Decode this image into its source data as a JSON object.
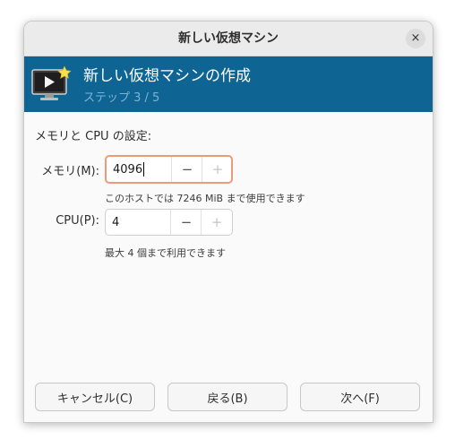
{
  "window": {
    "title": "新しい仮想マシン",
    "close_glyph": "×"
  },
  "banner": {
    "title": "新しい仮想マシンの作成",
    "step": "ステップ 3 / 5",
    "icon": "vm-monitor-icon",
    "accent_color": "#0e6594"
  },
  "form": {
    "section_title": "メモリと CPU の設定:",
    "memory": {
      "label": "メモリ(M):",
      "value": "4096",
      "decrement": "−",
      "increment": "+",
      "hint": "このホストでは 7246 MiB まで使用できます"
    },
    "cpu": {
      "label": "CPU(P):",
      "value": "4",
      "decrement": "−",
      "increment": "+",
      "hint": "最大 4 個まで利用できます"
    }
  },
  "footer": {
    "cancel": "キャンセル(C)",
    "back": "戻る(B)",
    "next": "次へ(F)"
  }
}
